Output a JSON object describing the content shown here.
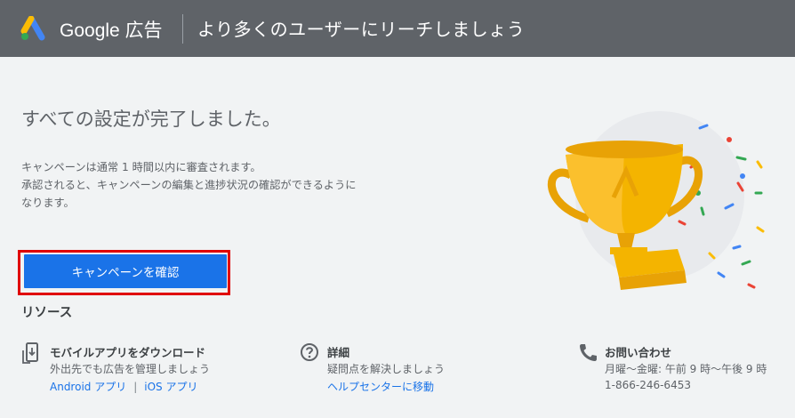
{
  "header": {
    "brand": "Google 広告",
    "title": "より多くのユーザーにリーチしましょう"
  },
  "main": {
    "headline": "すべての設定が完了しました。",
    "description_lines": [
      "キャンペーンは通常 1 時間以内に審査されます。",
      "承認されると、キャンペーンの編集と進捗状況の確認ができるように",
      "なります。"
    ],
    "cta_label": "キャンペーンを確認"
  },
  "resources": {
    "title": "リソース",
    "items": [
      {
        "icon": "mobile-download-icon",
        "title": "モバイルアプリをダウンロード",
        "subtitle": "外出先でも広告を管理しましょう",
        "links": [
          "Android アプリ",
          "iOS アプリ"
        ],
        "separator": "|"
      },
      {
        "icon": "help-icon",
        "title": "詳細",
        "subtitle": "疑問点を解決しましょう",
        "links": [
          "ヘルプセンターに移動"
        ]
      },
      {
        "icon": "phone-icon",
        "title": "お問い合わせ",
        "subtitle": "月曜～金曜: 午前 9 時～午後 9 時",
        "phone": "1-866-246-6453"
      }
    ]
  },
  "colors": {
    "topbar": "#5f6368",
    "primary": "#1a73e8",
    "highlight": "#e00000",
    "trophy": "#f4b400"
  }
}
